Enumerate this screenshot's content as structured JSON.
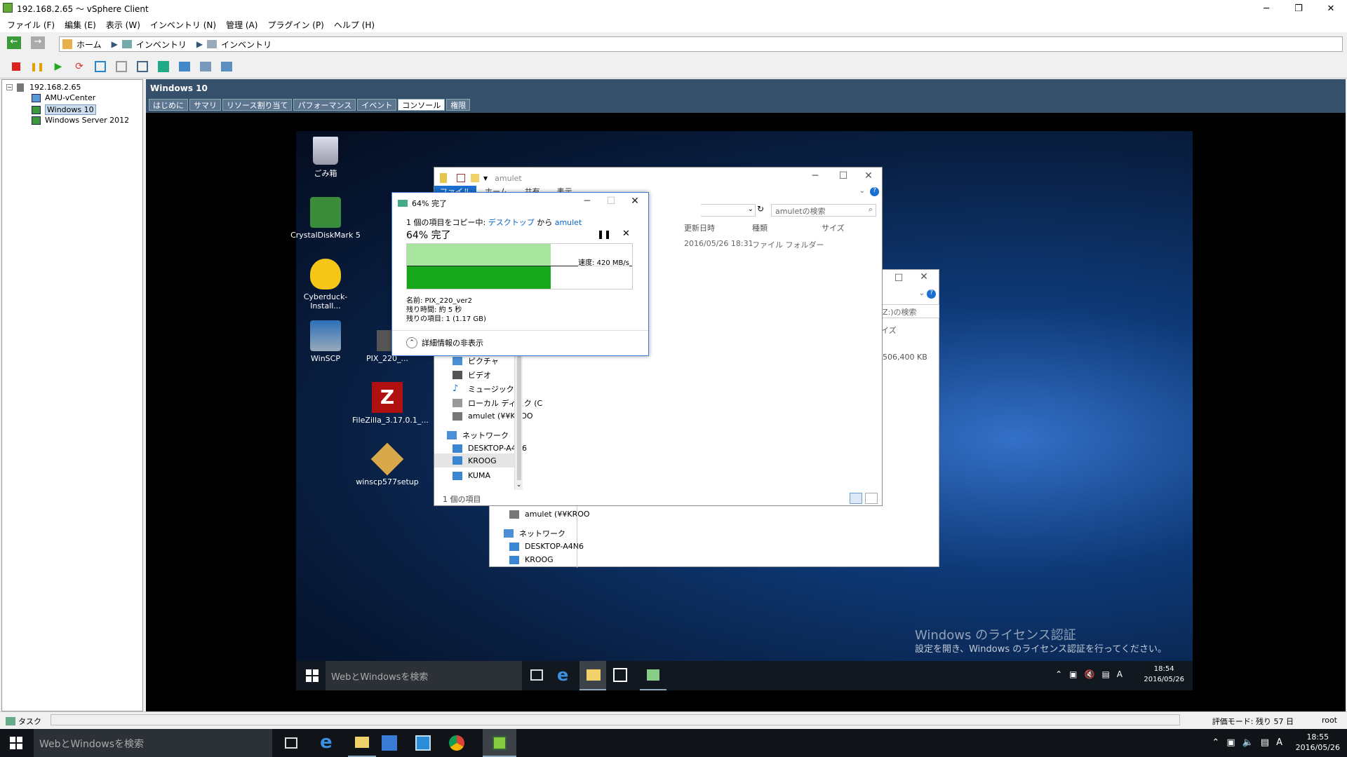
{
  "window": {
    "title": "192.168.2.65 ～ vSphere Client"
  },
  "menu": [
    "ファイル (F)",
    "編集 (E)",
    "表示 (W)",
    "インベントリ (N)",
    "管理 (A)",
    "プラグイン (P)",
    "ヘルプ (H)"
  ],
  "nav": {
    "home": "ホーム",
    "inventory1": "インベントリ",
    "inventory2": "インベントリ"
  },
  "tree": {
    "root": "192.168.2.65",
    "items": [
      "AMU-vCenter",
      "Windows 10",
      "Windows Server 2012"
    ]
  },
  "vm": {
    "title": "Windows 10",
    "tabs": [
      "はじめに",
      "サマリ",
      "リソース割り当て",
      "パフォーマンス",
      "イベント",
      "コンソール",
      "権限"
    ],
    "active_tab": "コンソール"
  },
  "desktop": {
    "icons": [
      "ごみ箱",
      "CrystalDiskMark 5",
      "Cyberduck-Install...",
      "WinSCP",
      "PIX_220_...",
      "FileZilla_3.17.0.1_...",
      "winscp577setup"
    ]
  },
  "explorer": {
    "title": "amulet",
    "ribbon": [
      "ファイル",
      "ホーム",
      "共有",
      "表示"
    ],
    "search_placeholder": "amuletの検索",
    "columns": [
      "更新日時",
      "種類",
      "サイズ"
    ],
    "row": {
      "date": "2016/05/26 18:31",
      "type": "ファイル フォルダー"
    },
    "nav_items": [
      "ピクチャ",
      "ビデオ",
      "ミュージック",
      "ローカル ディスク (C",
      "amulet (¥¥KROO",
      "ネットワーク",
      "DESKTOP-A4N6",
      "KROOG",
      "KUMA"
    ],
    "status": "1 個の項目"
  },
  "explorer2": {
    "search_placeholder": "Z:)の検索",
    "col": "イズ",
    "size": "506,400 KB",
    "nav_items": [
      "amulet (¥¥KROO",
      "ネットワーク",
      "DESKTOP-A4N6",
      "KROOG"
    ]
  },
  "copy": {
    "title": "64% 完了",
    "line1_prefix": "1 個の項目をコピー中:",
    "from": "デスクトップ",
    "from_sep": "から",
    "to": "amulet",
    "heading": "64% 完了",
    "speed": "速度: 420 MB/s",
    "progress": 0.64,
    "name": "名前: PIX_220_ver2",
    "remaining_time": "残り時間: 約 5 秒",
    "remaining_items": "残りの項目: 1 (1.17 GB)",
    "details": "詳細情報の非表示"
  },
  "vm_taskbar": {
    "search": "WebとWindowsを検索",
    "time": "18:54",
    "date": "2016/05/26",
    "ime": "A"
  },
  "watermark": {
    "line1": "Windows のライセンス認証",
    "line2": "設定を開き、Windows のライセンス認証を行ってください。"
  },
  "host_status": {
    "tasks": "タスク",
    "eval": "評価モード: 残り 57 日",
    "user": "root"
  },
  "host_taskbar": {
    "search": "WebとWindowsを検索",
    "time": "18:55",
    "date": "2016/05/26",
    "ime": "A"
  }
}
